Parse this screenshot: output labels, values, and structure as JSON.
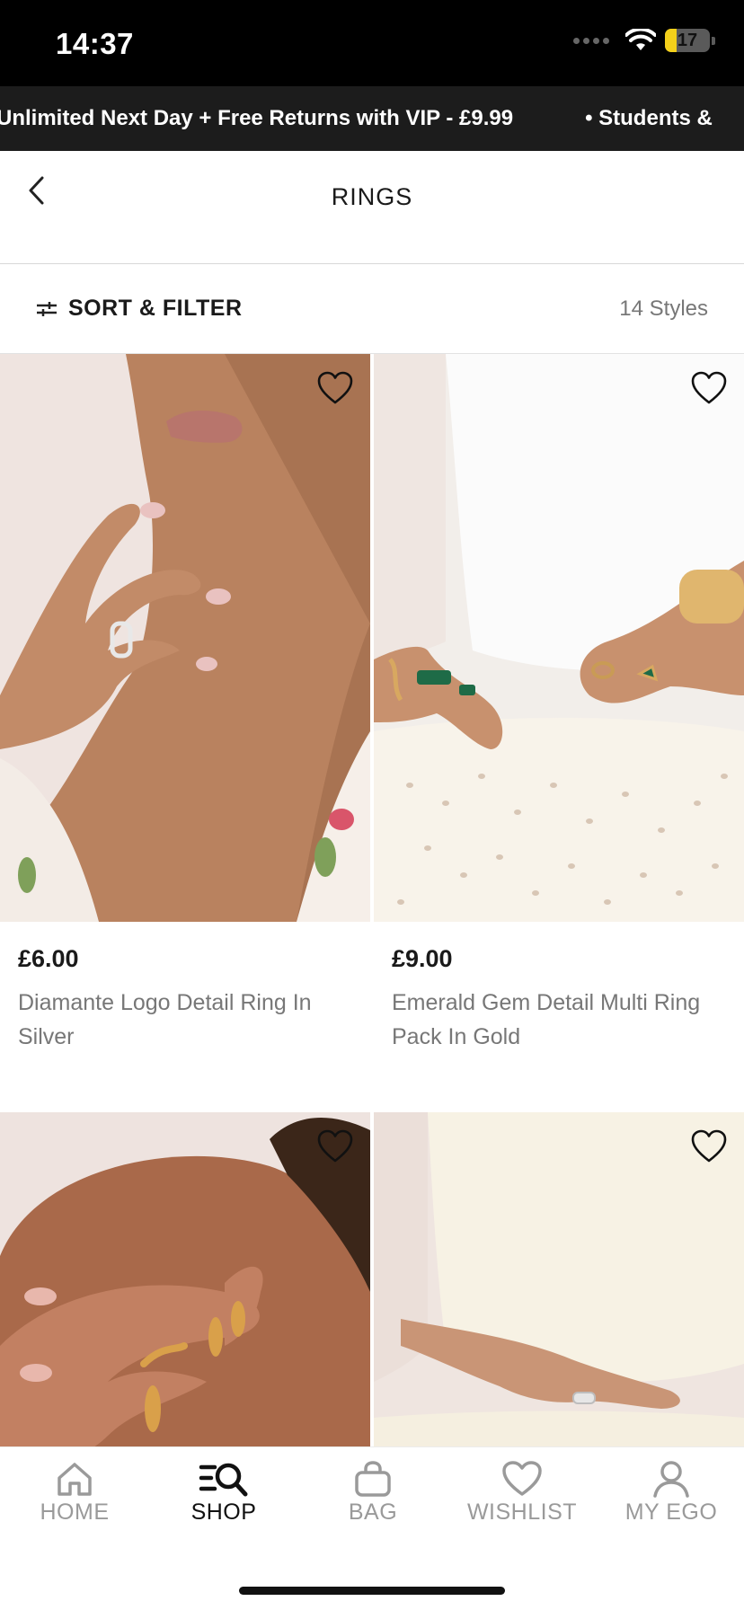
{
  "status_bar": {
    "time": "14:37",
    "battery": "17",
    "battery_level": 0.17
  },
  "promo": {
    "text_1": "Unlimited Next Day + Free Returns with VIP - £9.99",
    "text_2": "• Students &"
  },
  "header": {
    "title": "RINGS"
  },
  "filter": {
    "label": "SORT & FILTER",
    "count": "14 Styles"
  },
  "products": [
    {
      "price": "£6.00",
      "name": "Diamante Logo Detail Ring In Silver"
    },
    {
      "price": "£9.00",
      "name": "Emerald Gem Detail Multi Ring Pack In Gold"
    }
  ],
  "tabs": [
    {
      "label": "HOME",
      "icon": "home-icon"
    },
    {
      "label": "SHOP",
      "icon": "search-menu-icon"
    },
    {
      "label": "BAG",
      "icon": "bag-icon"
    },
    {
      "label": "WISHLIST",
      "icon": "heart-icon"
    },
    {
      "label": "MY EGO",
      "icon": "user-icon"
    }
  ],
  "colors": {
    "promo_bg": "#1c1c1c",
    "battery": "#f4d01a",
    "active_tab": "#111111",
    "inactive_tab": "#9a9a9a"
  }
}
